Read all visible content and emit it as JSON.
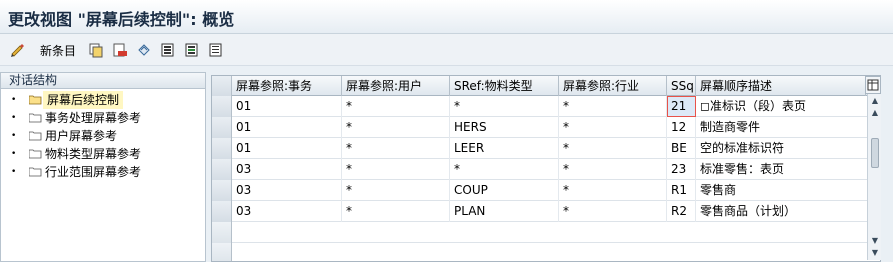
{
  "title": "更改视图 \"屏幕后续控制\": 概览",
  "toolbar": {
    "new_entries_label": "新条目",
    "icons": [
      "glasses-edit-icon",
      "copy-icon",
      "delete-icon",
      "undo-icon",
      "select-all-icon",
      "select-block-icon",
      "deselect-all-icon"
    ]
  },
  "tree": {
    "header": "对话结构",
    "items": [
      {
        "label": "屏幕后续控制",
        "selected": true
      },
      {
        "label": "事务处理屏幕参考",
        "selected": false
      },
      {
        "label": "用户屏幕参考",
        "selected": false
      },
      {
        "label": "物料类型屏幕参考",
        "selected": false
      },
      {
        "label": "行业范围屏幕参考",
        "selected": false
      }
    ]
  },
  "table": {
    "columns": [
      "屏幕参照:事务",
      "屏幕参照:用户",
      "SRef:物料类型",
      "屏幕参照:行业",
      "SSq",
      "屏幕顺序描述"
    ],
    "rows": [
      [
        "01",
        "*",
        "*",
        "*",
        "21",
        "◻准标识（段）表页"
      ],
      [
        "01",
        "*",
        "HERS",
        "*",
        "12",
        "制造商零件"
      ],
      [
        "01",
        "*",
        "LEER",
        "*",
        "BE",
        "空的标准标识符"
      ],
      [
        "03",
        "*",
        "*",
        "*",
        "23",
        "标准零售：表页"
      ],
      [
        "03",
        "*",
        "COUP",
        "*",
        "R1",
        "零售商"
      ],
      [
        "03",
        "*",
        "PLAN",
        "*",
        "R2",
        "零售商品（计划）"
      ]
    ]
  },
  "colors": {
    "title": "#1a2d44",
    "selected_tree_bg": "#fff7c2",
    "focus_outline": "#e8524a"
  }
}
